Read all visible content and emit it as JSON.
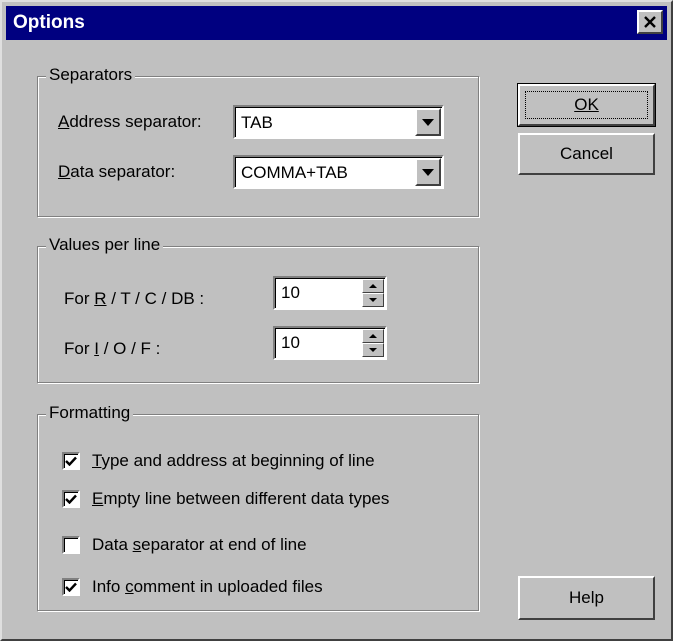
{
  "window": {
    "title": "Options"
  },
  "separators": {
    "legend": "Separators",
    "address_label_u": "A",
    "address_label_rest": "ddress separator:",
    "address_value": "TAB",
    "data_label_u": "D",
    "data_label_rest": "ata separator:",
    "data_value": "COMMA+TAB"
  },
  "values_per_line": {
    "legend": "Values per line",
    "rtcdb_pre": "For ",
    "rtcdb_u": "R",
    "rtcdb_post": " / T / C / DB :",
    "rtcdb_value": "10",
    "iof_pre": "For ",
    "iof_u": "I",
    "iof_post": " / O / F :",
    "iof_value": "10"
  },
  "formatting": {
    "legend": "Formatting",
    "items": [
      {
        "u": "T",
        "rest": "ype and address at beginning of line",
        "checked": true
      },
      {
        "u": "E",
        "rest": "mpty line between different data types",
        "checked": true
      },
      {
        "pre": "Data ",
        "u": "s",
        "rest": "eparator at end of line",
        "checked": false
      },
      {
        "pre": "Info ",
        "u": "c",
        "rest": "omment in uploaded files",
        "checked": true
      }
    ]
  },
  "buttons": {
    "ok": "OK",
    "cancel": "Cancel",
    "help": "Help"
  }
}
